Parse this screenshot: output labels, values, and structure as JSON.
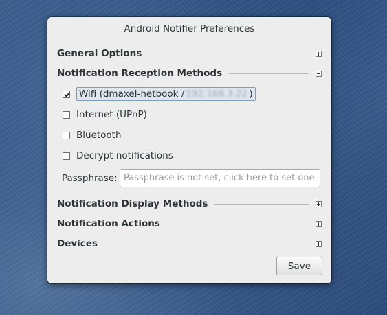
{
  "dialog": {
    "title": "Android Notifier Preferences",
    "sections": {
      "general": {
        "label": "General Options",
        "expanded": false
      },
      "reception": {
        "label": "Notification Reception Methods",
        "expanded": true
      },
      "display": {
        "label": "Notification Display Methods",
        "expanded": false
      },
      "actions": {
        "label": "Notification Actions",
        "expanded": false
      },
      "devices": {
        "label": "Devices",
        "expanded": false
      }
    },
    "reception": {
      "wifi": {
        "label": "Wifi (dmaxel-netbook /",
        "redacted": "192.168.3.22",
        "suffix": ")",
        "checked": true
      },
      "internet": {
        "label": "Internet (UPnP)",
        "checked": false
      },
      "bluetooth": {
        "label": "Bluetooth",
        "checked": false
      },
      "decrypt": {
        "label": "Decrypt notifications",
        "checked": false
      },
      "passphrase_label": "Passphrase:",
      "passphrase_value": "",
      "passphrase_placeholder": "Passphrase is not set, click here to set one"
    },
    "save_label": "Save"
  },
  "colors": {
    "dialog_bg": "#ededed",
    "desktop_bg": "#3c5f8e",
    "focus_highlight": "#dfe6ef"
  },
  "icons": [
    "expander-plus-icon",
    "expander-minus-icon",
    "checkbox-checked-icon",
    "checkbox-unchecked-icon"
  ]
}
